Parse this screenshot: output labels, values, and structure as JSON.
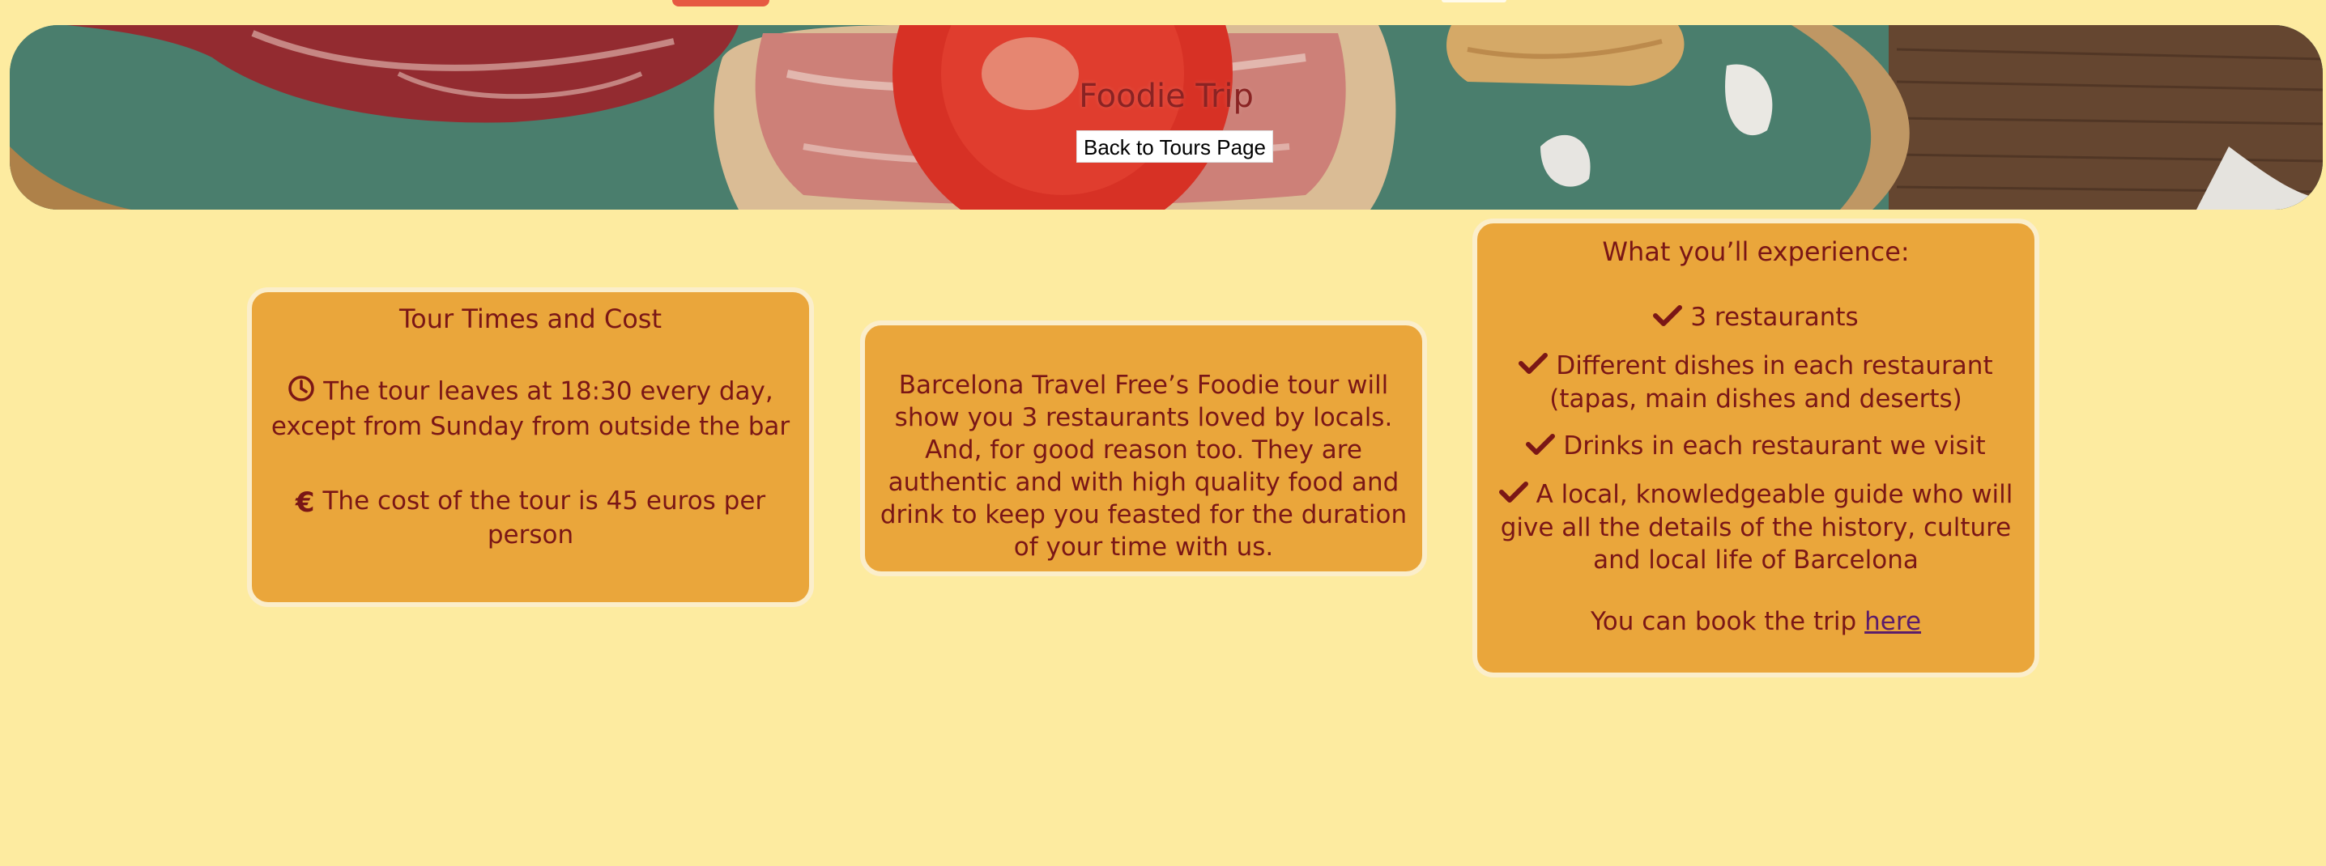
{
  "hero": {
    "title": "Foodie Trip",
    "back_button_label": "Back to Tours Page"
  },
  "times_card": {
    "title": "Tour Times and Cost",
    "time_icon": "clock-icon",
    "time_text": "The tour leaves at 18:30 every day, except from Sunday from outside the bar",
    "cost_icon": "euro-icon",
    "cost_text": "The cost of the tour is 45 euros per person"
  },
  "description_card": {
    "text": "Barcelona Travel Free’s Foodie tour will show you 3 restaurants loved by locals. And, for good reason too. They are authentic and with high quality food and drink to keep you feasted for the duration of your time with us."
  },
  "experience_card": {
    "title": "What you’ll experience:",
    "item_icon": "check-icon",
    "items": [
      "3 restaurants",
      "Different dishes in each restaurant (tapas, main dishes and deserts)",
      "Drinks in each restaurant we visit",
      "A local, knowledgeable guide who will give all the details of the history, culture and local life of Barcelona"
    ],
    "booking_text": "You can book the trip",
    "booking_link": "here"
  },
  "colors": {
    "page_background": "#fdeba0",
    "card_background": "#eaa63b",
    "card_border": "#fbeecb",
    "text": "#7a1616",
    "link": "#5b1c6b"
  }
}
